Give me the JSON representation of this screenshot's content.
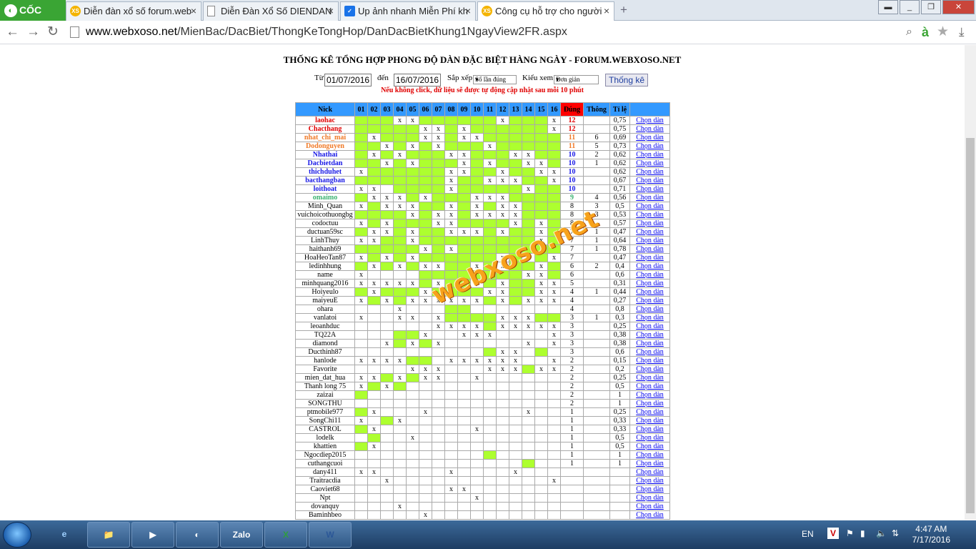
{
  "browser": {
    "brand": "CỐC CỐC",
    "tabs": [
      {
        "label": "Diễn đàn xổ số forum.web",
        "icon": "xs-favicon"
      },
      {
        "label": "Diễn Đàn Xổ Số DIENDAN",
        "icon": "page-favicon"
      },
      {
        "label": "Up ảnh nhanh Miễn Phí kh",
        "icon": "check-favicon"
      },
      {
        "label": "Công cụ hỗ trợ cho người",
        "icon": "xs-favicon"
      }
    ],
    "new_tab": "+",
    "url_domain": "www.webxoso.net",
    "url_path": "/MienBac/DacBiet/ThongKeTongHop/DanDacBietKhung1NgayView2FR.aspx"
  },
  "page": {
    "title": "THỐNG KÊ TỔNG HỢP PHONG ĐỘ DÀN ĐẶC BIỆT HÀNG NGÀY - FORUM.WEBXOSO.NET",
    "filter": {
      "from_label": "Từ",
      "from_value": "01/07/2016",
      "to_label": "đến",
      "to_value": "16/07/2016",
      "sort_label": "Sắp xếp",
      "sort_value": "Số lần đúng",
      "view_label": "Kiểu xem",
      "view_value": "Đơn giản",
      "submit_label": "Thống kê"
    },
    "note": "Nếu không click, dữ liệu sẽ được tự động cập nhật sau mỗi 10 phút",
    "watermark": "webxoso.net"
  },
  "table": {
    "headers": {
      "nick": "Nick",
      "days": [
        "01",
        "02",
        "03",
        "04",
        "05",
        "06",
        "07",
        "08",
        "09",
        "10",
        "11",
        "12",
        "13",
        "14",
        "15",
        "16"
      ],
      "dung": "Đúng",
      "thong": "Thông",
      "tile": "Tỉ lệ"
    },
    "link_label": "Chọn dàn",
    "colors": {
      "header": "#3399ff",
      "dung_header": "#ff0000",
      "hit": "#adff2f",
      "red": "#e00000",
      "orange": "#f07a28",
      "blue": "#1a1ae6",
      "green": "#3cb371"
    },
    "rows": [
      {
        "nick": "laohac",
        "color": "red",
        "d": "GGGxxGGGGGGxGGGx",
        "dung": "12",
        "thong": "",
        "tile": "0,75"
      },
      {
        "nick": "Chacthang",
        "color": "red",
        "d": "GGGGGxxGxGGGGGGx",
        "dung": "12",
        "thong": "",
        "tile": "0,75"
      },
      {
        "nick": "nhat_chi_mai",
        "color": "orange",
        "d": "GxGGGxxGxxGGGGGG",
        "dung": "11",
        "thong": "6",
        "tile": "0,69"
      },
      {
        "nick": "Dodonguyen",
        "color": "orange",
        "d": "GGxGxGxGGGxGGGGG",
        "dung": "11",
        "thong": "5",
        "tile": "0,73"
      },
      {
        "nick": "Nhathai",
        "color": "blue",
        "d": "GxGxGGGxxGGGxxGG",
        "dung": "10",
        "thong": "2",
        "tile": "0,62"
      },
      {
        "nick": "Dacbietdan",
        "color": "blue",
        "d": "GGxGxGGGxGxGGxxG",
        "dung": "10",
        "thong": "1",
        "tile": "0,62"
      },
      {
        "nick": "thichduhet",
        "color": "blue",
        "d": "xGGGGGGxxGGxGGxx",
        "dung": "10",
        "thong": "",
        "tile": "0,62"
      },
      {
        "nick": "bacthangban",
        "color": "blue",
        "d": "GGGGGGGxGGxxxGGx",
        "dung": "10",
        "thong": "",
        "tile": "0,67"
      },
      {
        "nick": "loithoat",
        "color": "blue",
        "d": "xx.GGGGxGGGGGxGG",
        "dung": "10",
        "thong": "",
        "tile": "0,71"
      },
      {
        "nick": "omaimo",
        "color": "green",
        "d": "GxxxGxGGGxxxGGGG",
        "dung": "9",
        "thong": "4",
        "tile": "0,56"
      },
      {
        "nick": "Minh_Quan",
        "color": "",
        "d": "xGxxxGGxGxGxxGGG",
        "dung": "8",
        "thong": "3",
        "tile": "0,5"
      },
      {
        "nick": "vuichoicothuongbg",
        "color": "",
        "d": "GGGGxGxxGxxxxGGG",
        "dung": "8",
        "thong": "3",
        "tile": "0,53"
      },
      {
        "nick": "codoctuu",
        "color": "",
        "d": "xGxGGGxxGGGGxGxG",
        "dung": "8",
        "thong": "",
        "tile": "0,57"
      },
      {
        "nick": "ductuan59sc",
        "color": "",
        "d": "GxxGxGGxxxGxGGxG",
        "dung": "7",
        "thong": "1",
        "tile": "0,47"
      },
      {
        "nick": "LinhThuy",
        "color": "",
        "d": "xxGGxGGGGGGGGGxG",
        "dung": "7",
        "thong": "1",
        "tile": "0,64"
      },
      {
        "nick": "haithanh69",
        "color": "",
        "d": "GGGGGxGxGGGGGGGG",
        "dung": "7",
        "thong": "1",
        "tile": "0,78"
      },
      {
        "nick": "HoaHeoTan87",
        "color": "",
        "d": "xGxGxGGGGGGxGxGx",
        "dung": "7",
        "thong": "",
        "tile": "0,47"
      },
      {
        "nick": "ledinhhung",
        "color": "",
        "d": "GxGxGxxGGxGxGGxG",
        "dung": "6",
        "thong": "2",
        "tile": "0,4"
      },
      {
        "nick": "name",
        "color": "",
        "d": "x....GGGGGGGGxxG",
        "dung": "6",
        "thong": "",
        "tile": "0,6"
      },
      {
        "nick": "minhquang2016",
        "color": "",
        "d": "xxxxxGxGGxGxGGxx",
        "dung": "5",
        "thong": "",
        "tile": "0,31"
      },
      {
        "nick": "Hoiyeulo",
        "color": "",
        "d": "GxGGGxGGGGxxGGxx",
        "dung": "4",
        "thong": "1",
        "tile": "0,44"
      },
      {
        "nick": "maiyeuE",
        "color": "",
        "d": "xGxGxxxxxxGxGxxx",
        "dung": "4",
        "thong": "",
        "tile": "0,27"
      },
      {
        "nick": "ohara",
        "color": "",
        "d": "...x...GG.......",
        "dung": "4",
        "thong": "",
        "tile": "0,8"
      },
      {
        "nick": "vanlatoi",
        "color": "",
        "d": "x..xx.xGGGGxxxGG",
        "dung": "3",
        "thong": "1",
        "tile": "0,3"
      },
      {
        "nick": "leoanhduc",
        "color": "",
        "d": "......xxxxGxxxxx",
        "dung": "3",
        "thong": "",
        "tile": "0,25"
      },
      {
        "nick": "TQ22A",
        "color": "",
        "d": "...GGx..xxx....x",
        "dung": "3",
        "thong": "",
        "tile": "0,38"
      },
      {
        "nick": "diamond",
        "color": "",
        "d": "..xGxGx......x.x",
        "dung": "3",
        "thong": "",
        "tile": "0,38"
      },
      {
        "nick": "Ducthinh87",
        "color": "",
        "d": "..........Gxx.G.",
        "dung": "3",
        "thong": "",
        "tile": "0,6"
      },
      {
        "nick": "hanlode",
        "color": "",
        "d": "xxxxGG.xxxxxx..x",
        "dung": "2",
        "thong": "",
        "tile": "0,15"
      },
      {
        "nick": "Favorite",
        "color": "",
        "d": "....xxx...xxxGxx",
        "dung": "2",
        "thong": "",
        "tile": "0,2"
      },
      {
        "nick": "mien_dat_hua",
        "color": "",
        "d": "xxGxGxx..x......",
        "dung": "2",
        "thong": "",
        "tile": "0,25"
      },
      {
        "nick": "Thanh long 75",
        "color": "",
        "d": "xGxG............",
        "dung": "2",
        "thong": "",
        "tile": "0,5"
      },
      {
        "nick": "zaizai",
        "color": "",
        "d": "G...............",
        "dung": "2",
        "thong": "",
        "tile": "1"
      },
      {
        "nick": "SONGTHU",
        "color": "",
        "d": "................",
        "dung": "2",
        "thong": "",
        "tile": "1"
      },
      {
        "nick": "ptmobile977",
        "color": "",
        "d": "Gx...x.......x..",
        "dung": "1",
        "thong": "",
        "tile": "0,25"
      },
      {
        "nick": "SongChi11",
        "color": "",
        "d": "x.Gx............",
        "dung": "1",
        "thong": "",
        "tile": "0,33"
      },
      {
        "nick": "CASTROL",
        "color": "",
        "d": "Gx.......x......",
        "dung": "1",
        "thong": "",
        "tile": "0,33"
      },
      {
        "nick": "lodelk",
        "color": "",
        "d": ".G..x...........",
        "dung": "1",
        "thong": "",
        "tile": "0,5"
      },
      {
        "nick": "khattien",
        "color": "",
        "d": "Gx..............",
        "dung": "1",
        "thong": "",
        "tile": "0,5"
      },
      {
        "nick": "Ngocdiep2015",
        "color": "",
        "d": "..........G.....",
        "dung": "1",
        "thong": "",
        "tile": "1"
      },
      {
        "nick": "cuthangcuoi",
        "color": "",
        "d": ".............G..",
        "dung": "1",
        "thong": "",
        "tile": "1"
      },
      {
        "nick": "dany411",
        "color": "",
        "d": "xx.....x....x...",
        "dung": "",
        "thong": "",
        "tile": ""
      },
      {
        "nick": "Traitracdia",
        "color": "",
        "d": "..x............x",
        "dung": "",
        "thong": "",
        "tile": ""
      },
      {
        "nick": "Caoviet68",
        "color": "",
        "d": ".......xx.......",
        "dung": "",
        "thong": "",
        "tile": ""
      },
      {
        "nick": "Npt",
        "color": "",
        "d": ".........x......",
        "dung": "",
        "thong": "",
        "tile": ""
      },
      {
        "nick": "dovanquy",
        "color": "",
        "d": "...x............",
        "dung": "",
        "thong": "",
        "tile": ""
      },
      {
        "nick": "Baminhbeo",
        "color": "",
        "d": ".....x..........",
        "dung": "",
        "thong": "",
        "tile": ""
      }
    ]
  },
  "taskbar": {
    "apps": [
      "explorer-icon",
      "ie-icon",
      "media-icon",
      "coccoc-icon",
      "zalo-icon",
      "excel-icon",
      "word-icon"
    ],
    "zalo": "Zalo",
    "lang": "EN",
    "time": "4:47 AM",
    "date": "7/17/2016"
  }
}
